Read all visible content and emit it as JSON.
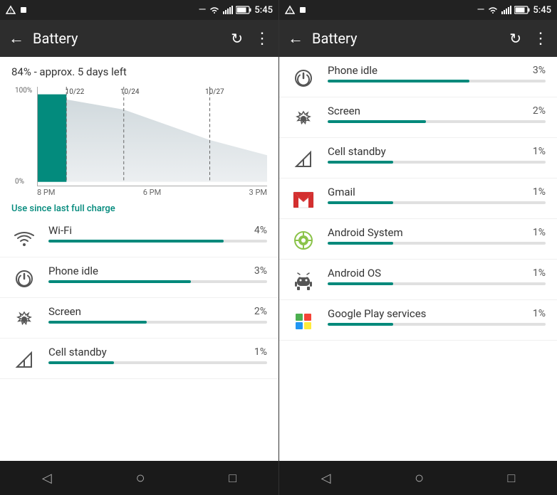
{
  "left": {
    "statusBar": {
      "leftIcons": [
        "alert-triangle",
        "notification"
      ],
      "time": "5:45",
      "rightIcons": [
        "minus-icon",
        "wifi-icon",
        "signal-icon",
        "battery-icon"
      ]
    },
    "toolbar": {
      "backLabel": "←",
      "title": "Battery",
      "refreshLabel": "↻",
      "moreLabel": "⋮"
    },
    "summary": "84% - approx. 5 days left",
    "chart": {
      "yLabels": [
        "100%",
        "0%"
      ],
      "xLabels": [
        "8 PM",
        "6 PM",
        "3 PM"
      ],
      "dataDates": [
        "10/22",
        "10/24",
        "10/27"
      ]
    },
    "useSinceLabel": "Use since last full charge",
    "items": [
      {
        "name": "Wi-Fi",
        "pct": "4%",
        "pctNum": 80,
        "icon": "wifi"
      },
      {
        "name": "Phone idle",
        "pct": "3%",
        "pctNum": 65,
        "icon": "power"
      },
      {
        "name": "Screen",
        "pct": "2%",
        "pctNum": 45,
        "icon": "brightness"
      },
      {
        "name": "Cell standby",
        "pct": "1%",
        "pctNum": 30,
        "icon": "signal"
      }
    ],
    "navBar": {
      "back": "◁",
      "home": "○",
      "recent": "□"
    }
  },
  "right": {
    "statusBar": {
      "time": "5:45"
    },
    "toolbar": {
      "backLabel": "←",
      "title": "Battery",
      "refreshLabel": "↻",
      "moreLabel": "⋮"
    },
    "items": [
      {
        "name": "Phone idle",
        "pct": "3%",
        "pctNum": 65,
        "icon": "power"
      },
      {
        "name": "Screen",
        "pct": "2%",
        "pctNum": 45,
        "icon": "brightness"
      },
      {
        "name": "Cell standby",
        "pct": "1%",
        "pctNum": 30,
        "icon": "signal"
      },
      {
        "name": "Gmail",
        "pct": "1%",
        "pctNum": 30,
        "icon": "gmail"
      },
      {
        "name": "Android System",
        "pct": "1%",
        "pctNum": 30,
        "icon": "android-system"
      },
      {
        "name": "Android OS",
        "pct": "1%",
        "pctNum": 30,
        "icon": "android"
      },
      {
        "name": "Google Play services",
        "pct": "1%",
        "pctNum": 30,
        "icon": "play"
      }
    ],
    "navBar": {
      "back": "◁",
      "home": "○",
      "recent": "□"
    }
  }
}
